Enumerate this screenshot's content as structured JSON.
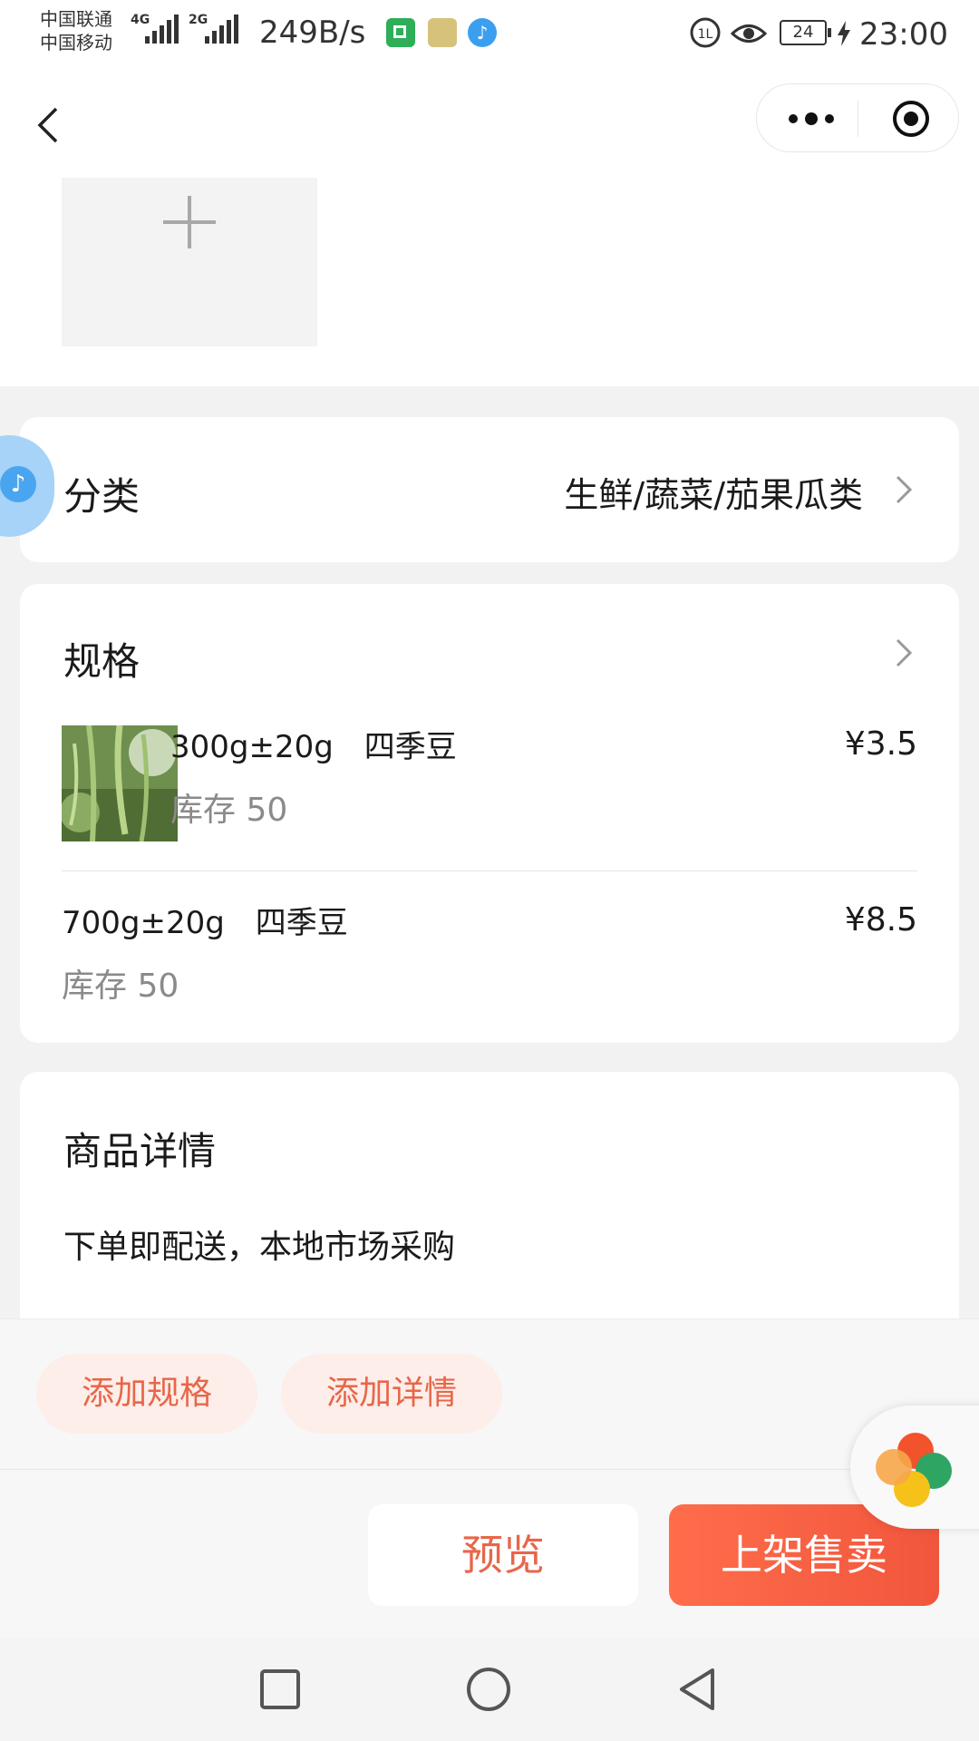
{
  "status_bar": {
    "carrier_1": "中国联通",
    "carrier_2": "中国移动",
    "net_type_1": "4G",
    "net_type_2": "2G",
    "net_speed": "249B/s",
    "battery": "24",
    "time": "23:00"
  },
  "nav": {
    "back_icon": "chevron-left-icon",
    "more_icon": "more-dots-icon",
    "close_icon": "target-circle-icon"
  },
  "image_area": {
    "add_icon": "plus-icon"
  },
  "category": {
    "label": "分类",
    "value": "生鲜/蔬菜/茄果瓜类"
  },
  "spec": {
    "title": "规格",
    "items": [
      {
        "name": "300g±20g　四季豆",
        "stock": "库存 50",
        "price": "¥3.5"
      },
      {
        "name": "700g±20g　四季豆",
        "stock": "库存 50",
        "price": "¥8.5"
      }
    ]
  },
  "detail": {
    "title": "商品详情",
    "text": "下单即配送，本地市场采购"
  },
  "actions": {
    "add_spec": "添加规格",
    "add_detail": "添加详情"
  },
  "bottom": {
    "preview": "预览",
    "publish": "上架售卖"
  },
  "colors": {
    "accent": "#F1563C",
    "accent_light": "#FDEEE9",
    "page_bg": "#F2F2F2"
  }
}
